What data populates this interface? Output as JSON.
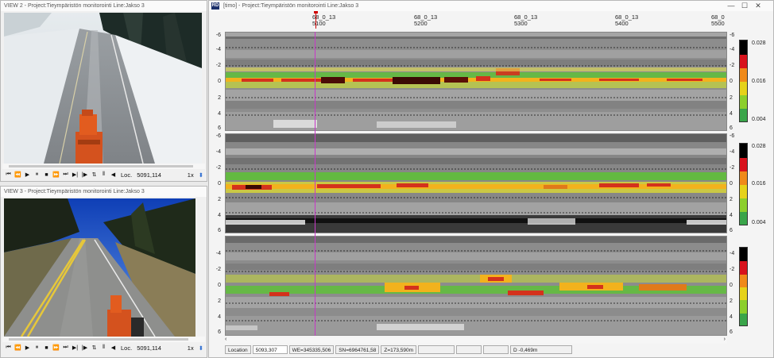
{
  "view2": {
    "title": "VIEW 2 - Project:Tieympäristön monitorointi  Line:Jakso 3",
    "loc_label": "Loc.",
    "loc_value": "5091,114",
    "speed": "1x",
    "controls": [
      "⏮",
      "⏪",
      "▶",
      "⏸",
      "■",
      "⏩",
      "⏭",
      "⏭",
      "⧐",
      "⧐",
      "♯",
      "◀"
    ]
  },
  "view3": {
    "title": "VIEW 3 - Project:Tieympäristön monitorointi  Line:Jakso 3",
    "loc_label": "Loc.",
    "loc_value": "5091,114",
    "speed": "1x"
  },
  "radar": {
    "badge": "RD",
    "title": "[timo] - Project:Tieympäristön monitorointi  Line:Jakso 3",
    "window_buttons": [
      "—",
      "☐",
      "✕"
    ],
    "top_ticks": [
      {
        "line1": "68_0_13",
        "line2": "5100"
      },
      {
        "line1": "68_0_13",
        "line2": "5200"
      },
      {
        "line1": "68_0_13",
        "line2": "5300"
      },
      {
        "line1": "68_0_13",
        "line2": "5400"
      },
      {
        "line1": "68_0",
        "line2": "5500"
      }
    ],
    "y_ticks": [
      "-6",
      "-4",
      "-2",
      "0",
      "2",
      "4",
      "6"
    ],
    "colorbar_labels": [
      "0.028",
      "0.016",
      "0.004"
    ],
    "status": {
      "location_label": "Location",
      "location_value": "5093,307",
      "we": "WE=345335,506",
      "sn": "SN=6964761,58",
      "z": "Z=173,590m",
      "d": "D -0,469m"
    }
  },
  "colors": {
    "accent_cursor": "#c838c8",
    "marker_red": "#d00000",
    "titlebar": "#fafafa"
  }
}
